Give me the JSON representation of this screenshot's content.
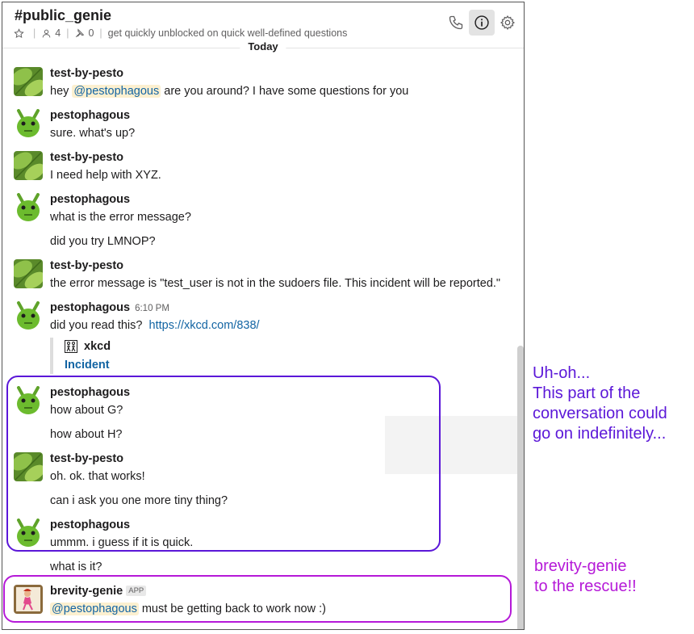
{
  "header": {
    "channel_name": "#public_genie",
    "members_count": "4",
    "pins_count": "0",
    "topic": "get quickly unblocked on quick well-defined questions",
    "icons": [
      "phone-icon",
      "info-icon",
      "gear-icon"
    ]
  },
  "day_label": "Today",
  "messages": [
    {
      "sender": "test-by-pesto",
      "mention": "@pestophagous",
      "pre": "hey ",
      "text": " are you around? I have some questions for you"
    },
    {
      "sender": "pestophagous",
      "text": "sure. what's up?"
    },
    {
      "sender": "test-by-pesto",
      "text": "I need help with XYZ."
    },
    {
      "sender": "pestophagous",
      "text": "what is the error message?",
      "text2": "did you try LMNOP?"
    },
    {
      "sender": "test-by-pesto",
      "text": "the error message is \"test_user is not in the sudoers file. This incident will be reported.\""
    },
    {
      "sender": "pestophagous",
      "time": "6:10 PM",
      "text": "did you read this?",
      "link": "https://xkcd.com/838/"
    },
    {
      "sender": "pestophagous",
      "text": "how about G?",
      "text2": "how about H?"
    },
    {
      "sender": "test-by-pesto",
      "text": "oh. ok. that works!",
      "text2": "can i ask you one more tiny thing?"
    },
    {
      "sender": "pestophagous",
      "text": "ummm. i guess if it is quick.",
      "text2": "what is it?"
    },
    {
      "sender": "brevity-genie",
      "badge": "APP",
      "mention": "@pestophagous",
      "text": " must be getting back to work now :)"
    }
  ],
  "attachment": {
    "site": "xkcd",
    "title": "Incident"
  },
  "annotations": {
    "note1": [
      "Uh-oh...",
      "This part of the",
      "conversation could",
      "go on indefinitely..."
    ],
    "note2": [
      "brevity-genie",
      "to the rescue!!"
    ]
  },
  "colors": {
    "note1": "#5b17d8",
    "note2": "#b519d8",
    "link": "#1264a3"
  }
}
